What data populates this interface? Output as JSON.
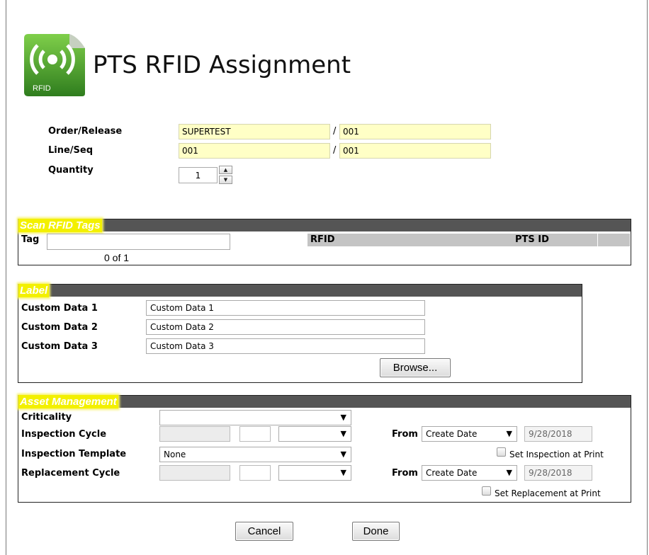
{
  "header": {
    "title": "PTS RFID Assignment",
    "logo_text": "RFID"
  },
  "order": {
    "order_label": "Order/Release",
    "order_value": "SUPERTEST",
    "release_value": "001",
    "line_label": "Line/Seq",
    "line_value": "001",
    "seq_value": "001",
    "separator": "/",
    "quantity_label": "Quantity",
    "quantity_value": "1"
  },
  "scan": {
    "title": "Scan RFID Tags",
    "tag_label": "Tag",
    "tag_value": "",
    "count_text": "0 of 1",
    "columns": [
      "RFID",
      "PTS ID"
    ]
  },
  "label": {
    "title": "Label",
    "fields": [
      {
        "label": "Custom Data 1",
        "value": "Custom Data 1"
      },
      {
        "label": "Custom Data 2",
        "value": "Custom Data 2"
      },
      {
        "label": "Custom Data 3",
        "value": "Custom Data 3"
      }
    ],
    "browse_label": "Browse..."
  },
  "asset": {
    "title": "Asset Management",
    "criticality_label": "Criticality",
    "criticality_value": "",
    "inspection_cycle_label": "Inspection Cycle",
    "inspection_template_label": "Inspection Template",
    "inspection_template_value": "None",
    "replacement_cycle_label": "Replacement Cycle",
    "from_label": "From",
    "inspection_from_value": "Create Date",
    "inspection_date": "9/28/2018",
    "replacement_from_value": "Create Date",
    "replacement_date": "9/28/2018",
    "set_inspection_label": "Set Inspection at Print",
    "set_replacement_label": "Set Replacement at Print",
    "dropdown_arrow": "▼"
  },
  "actions": {
    "cancel_label": "Cancel",
    "done_label": "Done"
  }
}
